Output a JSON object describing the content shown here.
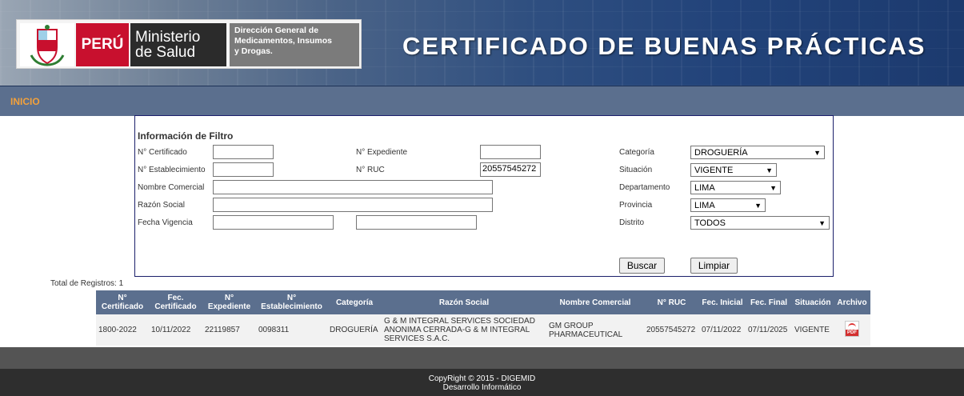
{
  "header": {
    "peru_label": "PERÚ",
    "ministerio_line1": "Ministerio",
    "ministerio_line2": "de Salud",
    "digemid_line1": "Dirección General de",
    "digemid_line2": "Medicamentos, Insumos",
    "digemid_line3": "y Drogas.",
    "title": "CERTIFICADO DE BUENAS PRÁCTICAS"
  },
  "nav": {
    "inicio": "INICIO"
  },
  "filter": {
    "title": "Información de Filtro",
    "labels": {
      "certificado": "N° Certificado",
      "establecimiento": "N° Establecimiento",
      "nombre_comercial": "Nombre Comercial",
      "razon_social": "Razón Social",
      "fecha_vigencia": "Fecha Vigencia",
      "expediente": "N° Expediente",
      "ruc": "N° RUC",
      "categoria": "Categoría",
      "situacion": "Situación",
      "departamento": "Departamento",
      "provincia": "Provincia",
      "distrito": "Distrito"
    },
    "values": {
      "certificado": "",
      "establecimiento": "",
      "nombre_comercial": "",
      "razon_social": "",
      "fecha_desde": "",
      "fecha_hasta": "",
      "expediente": "",
      "ruc": "20557545272",
      "categoria": "DROGUERÍA",
      "situacion": "VIGENTE",
      "departamento": "LIMA",
      "provincia": "LIMA",
      "distrito": "TODOS"
    },
    "buscar": "Buscar",
    "limpiar": "Limpiar"
  },
  "results": {
    "total_label": "Total de Registros: 1",
    "columns": [
      "N° Certificado",
      "Fec. Certificado",
      "N° Expediente",
      "N° Establecimiento",
      "Categoría",
      "Razón Social",
      "Nombre Comercial",
      "N° RUC",
      "Fec. Inicial",
      "Fec. Final",
      "Situación",
      "Archivo"
    ],
    "rows": [
      {
        "certificado": "1800-2022",
        "fec_certificado": "10/11/2022",
        "expediente": "22119857",
        "establecimiento": "0098311",
        "categoria": "DROGUERÍA",
        "razon_social": "G & M INTEGRAL SERVICES SOCIEDAD ANONIMA CERRADA-G & M INTEGRAL SERVICES S.A.C.",
        "nombre_comercial": "GM GROUP PHARMACEUTICAL",
        "ruc": "20557545272",
        "fec_inicial": "07/11/2022",
        "fec_final": "07/11/2025",
        "situacion": "VIGENTE",
        "archivo_icon": "pdf-icon",
        "archivo_label": "PDF"
      }
    ]
  },
  "footer": {
    "line1": "CopyRight © 2015 - DIGEMID",
    "line2": "Desarrollo Informático"
  }
}
